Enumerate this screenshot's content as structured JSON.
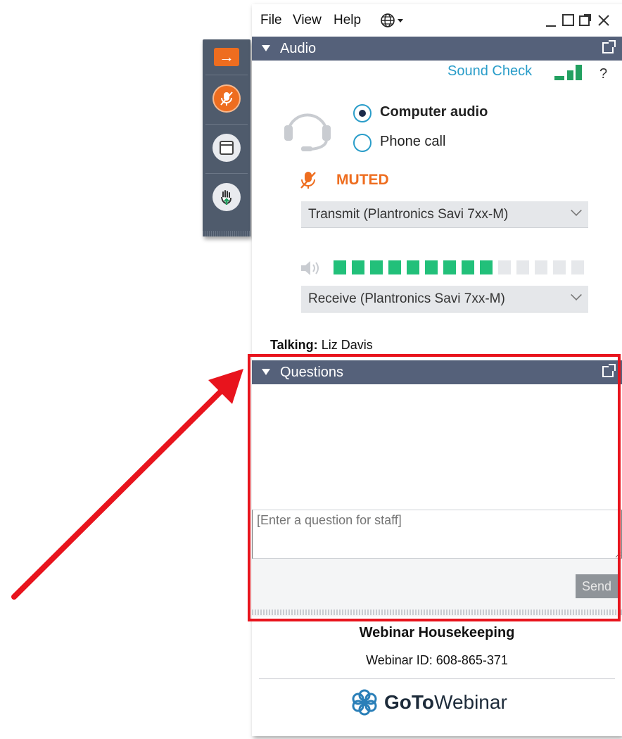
{
  "menu": {
    "file": "File",
    "view": "View",
    "help": "Help"
  },
  "audio_panel": {
    "title": "Audio",
    "sound_check": "Sound Check",
    "help": "?",
    "options": [
      {
        "label": "Computer audio",
        "selected": true
      },
      {
        "label": "Phone call",
        "selected": false
      }
    ],
    "mic_status": "MUTED",
    "transmit_device": "Transmit (Plantronics Savi 7xx-M)",
    "receive_device": "Receive (Plantronics Savi 7xx-M)",
    "speaker_level": {
      "lit_segments": 9,
      "total_segments": 14
    }
  },
  "talking": {
    "label": "Talking:",
    "name": "Liz Davis"
  },
  "questions_panel": {
    "title": "Questions",
    "input_placeholder": "[Enter a question for staff]",
    "send_label": "Send"
  },
  "footer": {
    "title": "Webinar Housekeeping",
    "webinar_id": "Webinar ID: 608-865-371",
    "brand_bold": "GoTo",
    "brand_rest": "Webinar"
  },
  "colors": {
    "accent_orange": "#ee6d1f",
    "header_bg": "#55617a",
    "link_blue": "#2a9dc9",
    "meter_green": "#22c07a",
    "highlight_red": "#e8141d"
  },
  "icons": [
    "arrow-right-icon",
    "muted-mic-icon",
    "window-icon",
    "raise-hand-icon",
    "globe-icon",
    "headset-icon",
    "speaker-icon",
    "popout-icon",
    "gotowebinar-logo-icon"
  ]
}
